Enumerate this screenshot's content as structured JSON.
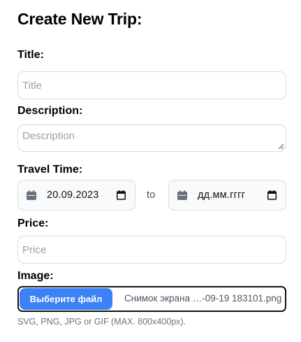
{
  "heading": "Create New Trip:",
  "title_field": {
    "label": "Title:",
    "placeholder": "Title"
  },
  "description_field": {
    "label": "Description:",
    "placeholder": "Description"
  },
  "travel_time": {
    "label": "Travel Time:",
    "start_value": "20.09.2023",
    "end_value": "дд.мм.гггг",
    "separator": "to",
    "calendar_icon": "calendar-icon"
  },
  "price_field": {
    "label": "Price:",
    "placeholder": "Price"
  },
  "image_field": {
    "label": "Image:",
    "button_label": "Выберите файл",
    "file_name": "Снимок экрана …-09-19 183101.png",
    "hint": "SVG, PNG, JPG or GIF (MAX. 800x400px)."
  },
  "colors": {
    "accent": "#3b82f6",
    "border": "#d8dce3",
    "placeholder": "#9aa0a9"
  }
}
